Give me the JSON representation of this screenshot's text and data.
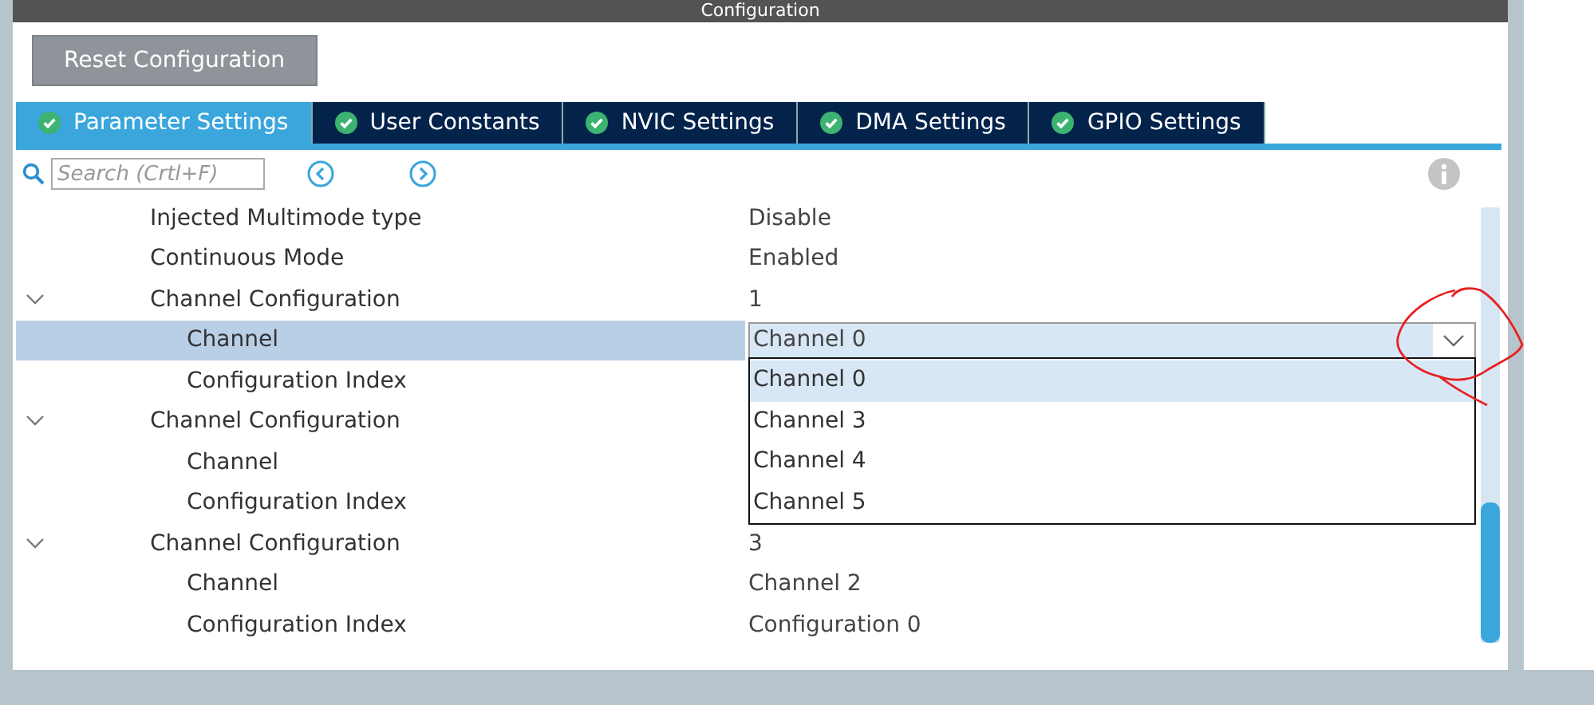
{
  "window": {
    "title": "Configuration"
  },
  "reset_button": "Reset Configuration",
  "tabs": [
    {
      "label": "Parameter Settings",
      "selected": true
    },
    {
      "label": "User Constants",
      "selected": false
    },
    {
      "label": "NVIC Settings",
      "selected": false
    },
    {
      "label": "DMA Settings",
      "selected": false
    },
    {
      "label": "GPIO Settings",
      "selected": false
    }
  ],
  "search": {
    "placeholder": "Search (Crtl+F)"
  },
  "tree": [
    {
      "name": "Injected Multimode type",
      "value": "Disable",
      "selected": false
    },
    {
      "name": "Continuous Mode",
      "value": "Enabled",
      "selected": false
    },
    {
      "name": "Channel Configuration",
      "value": "1",
      "expanded": true,
      "selected": false,
      "children": [
        {
          "name": "Channel",
          "selected": true,
          "combo": "Channel 0"
        },
        {
          "name": "Configuration Index",
          "selected": false
        }
      ]
    },
    {
      "name": "Channel Configuration",
      "expanded": true,
      "selected": false,
      "children": [
        {
          "name": "Channel",
          "selected": false
        },
        {
          "name": "Configuration Index",
          "selected": false
        }
      ]
    },
    {
      "name": "Channel Configuration",
      "value": "3",
      "expanded": true,
      "selected": false,
      "children": [
        {
          "name": "Channel",
          "value": "Channel 2",
          "selected": false
        },
        {
          "name": "Configuration Index",
          "value": "Configuration 0",
          "selected": false
        }
      ]
    }
  ],
  "dropdown_options": [
    {
      "label": "Channel 0",
      "selected": true
    },
    {
      "label": "Channel 3",
      "selected": false
    },
    {
      "label": "Channel 4",
      "selected": false
    },
    {
      "label": "Channel 5",
      "selected": false
    }
  ]
}
